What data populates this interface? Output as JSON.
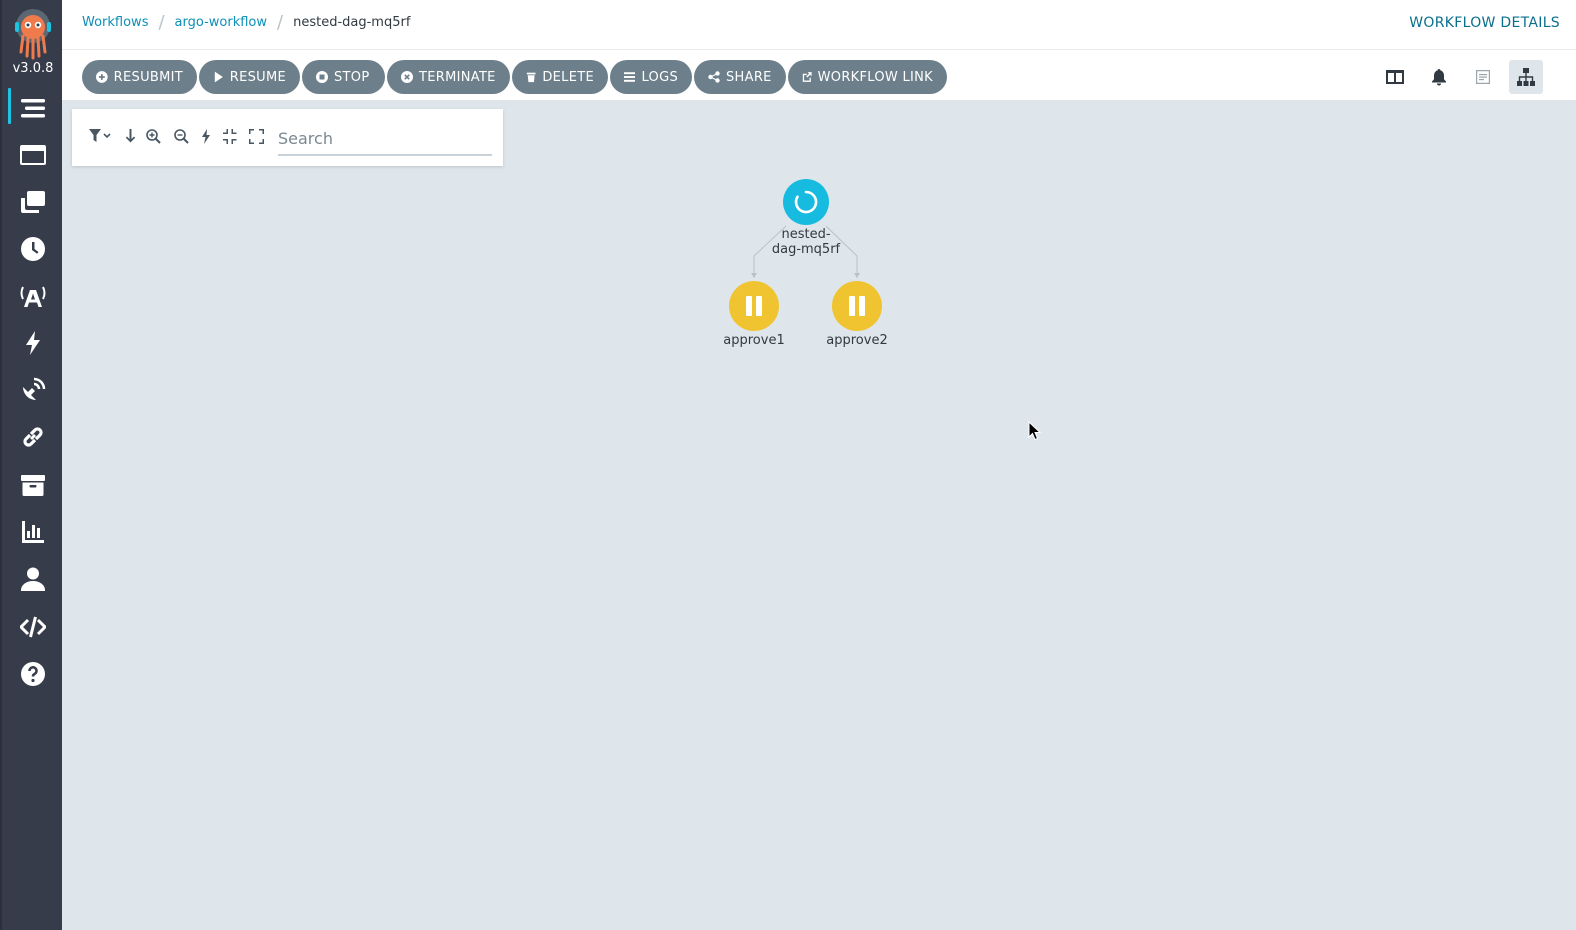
{
  "app": {
    "version": "v3.0.8",
    "accent_color": "#1dc4e2",
    "sidebar_bg": "#363c4a"
  },
  "sidebar": {
    "items": [
      {
        "name": "workflows",
        "icon": "stream-icon",
        "active": true
      },
      {
        "name": "workflow-templates",
        "icon": "window-icon"
      },
      {
        "name": "cluster-workflow-templates",
        "icon": "clone-icon"
      },
      {
        "name": "cron-workflows",
        "icon": "clock-icon"
      },
      {
        "name": "event-sources",
        "icon": "broadcast-icon"
      },
      {
        "name": "sensors",
        "icon": "bolt-icon"
      },
      {
        "name": "event-flow",
        "icon": "satellite-dish-icon"
      },
      {
        "name": "event-bus",
        "icon": "link-icon"
      },
      {
        "name": "archived-workflows",
        "icon": "archive-icon"
      },
      {
        "name": "reports",
        "icon": "chart-bar-icon"
      },
      {
        "name": "user",
        "icon": "user-icon"
      },
      {
        "name": "api-docs",
        "icon": "code-icon"
      },
      {
        "name": "help",
        "icon": "question-circle-icon"
      }
    ]
  },
  "header": {
    "breadcrumb": [
      {
        "label": "Workflows"
      },
      {
        "label": "argo-workflow"
      },
      {
        "label": "nested-dag-mq5rf"
      }
    ],
    "title": "WORKFLOW DETAILS"
  },
  "toolbar": {
    "buttons": [
      {
        "label": "RESUBMIT",
        "icon": "plus-circle-icon"
      },
      {
        "label": "RESUME",
        "icon": "play-icon"
      },
      {
        "label": "STOP",
        "icon": "stop-circle-icon"
      },
      {
        "label": "TERMINATE",
        "icon": "times-circle-icon"
      },
      {
        "label": "DELETE",
        "icon": "trash-icon"
      },
      {
        "label": "LOGS",
        "icon": "bars-icon"
      },
      {
        "label": "SHARE",
        "icon": "share-alt-icon"
      },
      {
        "label": "WORKFLOW LINK",
        "icon": "external-link-icon"
      }
    ],
    "view_icons": [
      "columns-icon",
      "bell-icon",
      "summary-icon",
      "sitemap-icon"
    ],
    "selected_view": "sitemap-icon"
  },
  "graph_panel": {
    "search_placeholder": "Search",
    "icons": [
      "filter-icon",
      "arrow-down-icon",
      "zoom-in-icon",
      "zoom-out-icon",
      "bolt-icon",
      "compress-icon",
      "expand-icon"
    ]
  },
  "graph": {
    "nodes": [
      {
        "id": "root",
        "label_line1": "nested-",
        "label_line2": "dag-mq5rf",
        "status": "running",
        "color": "#18bbe0"
      },
      {
        "id": "approve1",
        "label": "approve1",
        "status": "suspended",
        "color": "#f0c330"
      },
      {
        "id": "approve2",
        "label": "approve2",
        "status": "suspended",
        "color": "#f0c330"
      }
    ],
    "edges": [
      {
        "from": "root",
        "to": "approve1"
      },
      {
        "from": "root",
        "to": "approve2"
      }
    ]
  }
}
